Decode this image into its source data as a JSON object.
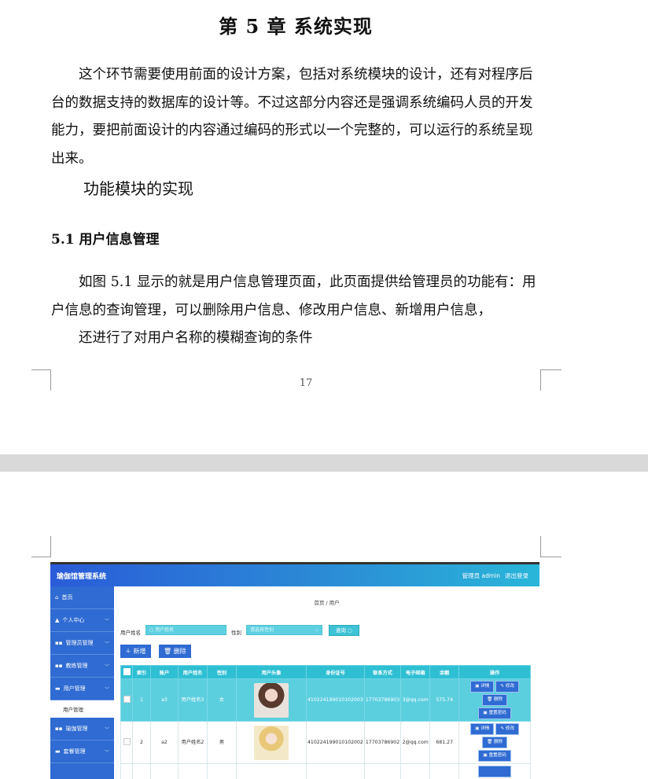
{
  "page1": {
    "chapter_title": "第 5 章  系统实现",
    "intro": "这个环节需要使用前面的设计方案，包括对系统模块的设计，还有对程序后台的数据支持的数据库的设计等。不过这部分内容还是强调系统编码人员的开发能力，要把前面设计的内容通过编码的形式以一个完整的，可以运行的系统呈现出来。",
    "func_heading": "功能模块的实现",
    "section_title": "5.1 用户信息管理",
    "para2": "如图 5.1 显示的就是用户信息管理页面，此页面提供给管理员的功能有：用户信息的查询管理，可以删除用户信息、修改用户信息、新增用户信息，",
    "para3": "还进行了对用户名称的模糊查询的条件",
    "page_number": "17"
  },
  "app": {
    "title": "瑜伽馆管理系统",
    "user": "管理员 admin",
    "logout": "退出登录",
    "sidebar": [
      {
        "label": "首页",
        "icon": "home-icon"
      },
      {
        "label": "个人中心",
        "icon": "user-icon"
      },
      {
        "label": "管理员管理",
        "icon": "grid-icon"
      },
      {
        "label": "教练管理",
        "icon": "grid-icon"
      },
      {
        "label": "用户管理",
        "icon": "card-icon"
      },
      {
        "label": "瑜伽管理",
        "icon": "grid-icon"
      },
      {
        "label": "套餐管理",
        "icon": "card-icon"
      }
    ],
    "sidebar_sub": "用户管理",
    "breadcrumb": "首页  /  用户",
    "filter": {
      "name_label": "用户姓名",
      "name_placeholder": "用户姓名",
      "gender_label": "性别",
      "gender_placeholder": "请选择性别",
      "query_button": "查询"
    },
    "add_button": "新增",
    "delete_button": "删除",
    "columns": [
      "",
      "索引",
      "账户",
      "用户姓名",
      "性别",
      "用户头像",
      "身份证号",
      "联系方式",
      "电子邮箱",
      "余额",
      "操作"
    ],
    "rows": [
      {
        "index": "1",
        "account": "a3",
        "name": "用户姓名3",
        "gender": "女",
        "id_card": "410224199010102003",
        "phone": "17703786903",
        "email": "3@qq.com",
        "balance": "575.74"
      },
      {
        "index": "2",
        "account": "a2",
        "name": "用户姓名2",
        "gender": "男",
        "id_card": "410224199010102002",
        "phone": "17703786902",
        "email": "2@qq.com",
        "balance": "681.27"
      }
    ],
    "actions": {
      "detail": "详情",
      "edit": "修改",
      "delete": "删除",
      "reset": "重置密码"
    }
  }
}
